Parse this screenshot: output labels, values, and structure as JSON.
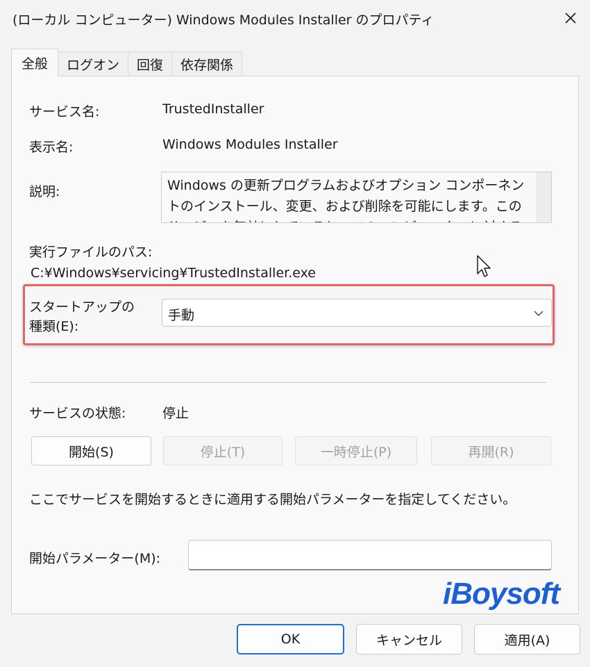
{
  "window": {
    "title": "(ローカル コンピューター) Windows Modules Installer のプロパティ"
  },
  "tabs": [
    {
      "label": "全般"
    },
    {
      "label": "ログオン"
    },
    {
      "label": "回復"
    },
    {
      "label": "依存関係"
    }
  ],
  "general": {
    "service_name_label": "サービス名:",
    "service_name_value": "TrustedInstaller",
    "display_name_label": "表示名:",
    "display_name_value": "Windows Modules Installer",
    "description_label": "説明:",
    "description_value": "Windows の更新プログラムおよびオプション コンポーネントのインストール、変更、および削除を可能にします。このサービスを無効にしていると、このコンピューターに対する Windows",
    "exe_path_label": "実行ファイルのパス:",
    "exe_path_value": "C:¥Windows¥servicing¥TrustedInstaller.exe",
    "startup_type_label_line1": "スタートアップの",
    "startup_type_label_line2": "種類(E):",
    "startup_type_value": "手動",
    "service_status_label": "サービスの状態:",
    "service_status_value": "停止",
    "start_button": "開始(S)",
    "stop_button": "停止(T)",
    "pause_button": "一時停止(P)",
    "resume_button": "再開(R)",
    "hint_text": "ここでサービスを開始するときに適用する開始パラメーターを指定してください。",
    "start_params_label": "開始パラメーター(M):",
    "start_params_value": ""
  },
  "footer": {
    "ok_button": "OK",
    "cancel_button": "キャンセル",
    "apply_button": "適用(A)"
  },
  "watermark": {
    "text": "iBoysoft"
  },
  "colors": {
    "highlight_border": "#e06565",
    "watermark": "#1e5fd4",
    "default_button_border": "#1f6fd6"
  }
}
